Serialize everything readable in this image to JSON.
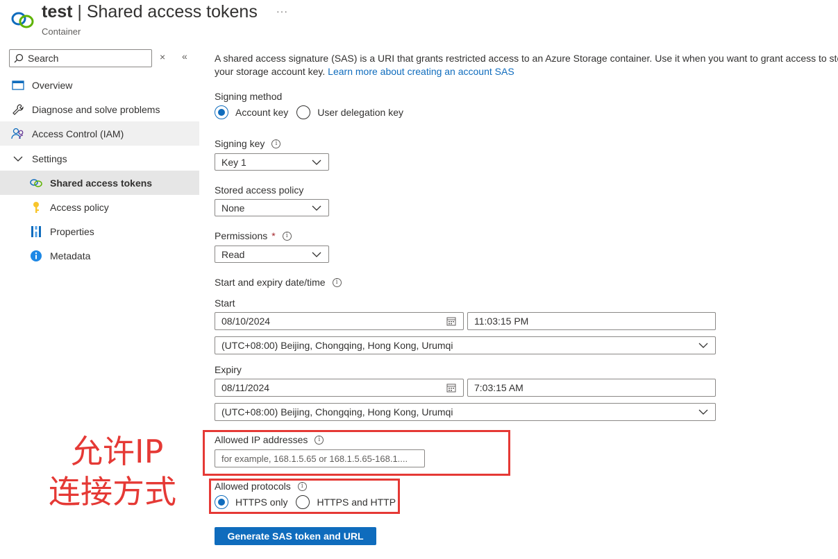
{
  "header": {
    "title_main": "test",
    "title_rest": " | Shared access tokens",
    "subtitle": "Container",
    "more": "···"
  },
  "sidebar": {
    "search_placeholder": "Search",
    "clear_glyph": "×",
    "collapse_glyph": "«",
    "items": [
      {
        "label": "Overview",
        "icon": "overview-icon"
      },
      {
        "label": "Diagnose and solve problems",
        "icon": "wrench-icon"
      },
      {
        "label": "Access Control (IAM)",
        "icon": "people-icon"
      },
      {
        "label": "Settings",
        "icon": "chevron-down-icon"
      },
      {
        "label": "Shared access tokens",
        "icon": "link-icon"
      },
      {
        "label": "Access policy",
        "icon": "key-icon"
      },
      {
        "label": "Properties",
        "icon": "properties-icon"
      },
      {
        "label": "Metadata",
        "icon": "info-icon"
      }
    ]
  },
  "main": {
    "description_1": "A shared access signature (SAS) is a URI that grants restricted access to an Azure Storage container. Use it when you want to grant access to storage account resources for a specific time range without sharing",
    "description_2": "your storage account key. ",
    "learn_more": "Learn more about creating an account SAS",
    "signing_method": {
      "label": "Signing method",
      "options": [
        "Account key",
        "User delegation key"
      ],
      "selected": "Account key"
    },
    "signing_key": {
      "label": "Signing key",
      "value": "Key 1"
    },
    "stored_policy": {
      "label": "Stored access policy",
      "value": "None"
    },
    "permissions": {
      "label": "Permissions",
      "required": "*",
      "value": "Read"
    },
    "datetime_label": "Start and expiry date/time",
    "start": {
      "label": "Start",
      "date": "08/10/2024",
      "time": "11:03:15 PM",
      "timezone": "(UTC+08:00) Beijing, Chongqing, Hong Kong, Urumqi"
    },
    "expiry": {
      "label": "Expiry",
      "date": "08/11/2024",
      "time": "7:03:15 AM",
      "timezone": "(UTC+08:00) Beijing, Chongqing, Hong Kong, Urumqi"
    },
    "allowed_ip": {
      "label": "Allowed IP addresses",
      "placeholder": "for example, 168.1.5.65 or 168.1.5.65-168.1...."
    },
    "protocols": {
      "label": "Allowed protocols",
      "options": [
        "HTTPS only",
        "HTTPS and HTTP"
      ],
      "selected": "HTTPS only"
    },
    "generate_button": "Generate SAS token and URL",
    "info_glyph": "i"
  },
  "annotation": {
    "line1": "允许IP",
    "line2": "连接方式",
    "color": "#e53935"
  },
  "colors": {
    "accent": "#0f6cbd",
    "annotation": "#e53935"
  }
}
